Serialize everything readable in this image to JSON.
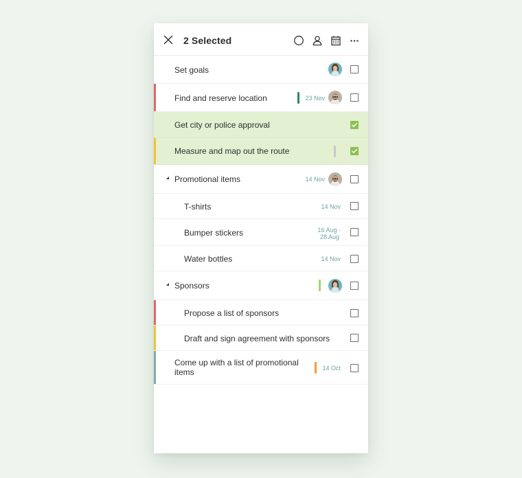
{
  "header": {
    "title": "2 Selected",
    "icons": [
      "close-icon",
      "circle-icon",
      "person-icon",
      "calendar-icon",
      "more-icon"
    ]
  },
  "colors": {
    "selected_bg": "#e3f0d2",
    "check_green": "#8cc152",
    "priority_red": "#e06666",
    "priority_yellow": "#f1c232",
    "priority_teal": "#7fa8b0",
    "tag_green": "#2e8b57",
    "tag_gray": "#c8c8c8",
    "tag_lightgreen": "#a7d36b",
    "tag_orange": "#f29d38",
    "date_color": "#6aa4a4"
  },
  "tasks": [
    {
      "label": "Set goals",
      "date": "",
      "avatar": "avatar-woman",
      "checked": false,
      "priority": "",
      "tag": ""
    },
    {
      "label": "Find and reserve location",
      "date": "23 Nov",
      "avatar": "avatar-man",
      "checked": false,
      "priority": "red",
      "tag": "green"
    },
    {
      "label": "Get city or police approval",
      "date": "",
      "avatar": "",
      "checked": true,
      "priority": "",
      "tag": ""
    },
    {
      "label": "Measure and map out the route",
      "date": "",
      "avatar": "",
      "checked": true,
      "priority": "yellow",
      "tag": "gray"
    },
    {
      "label": "Promotional items",
      "date": "14 Nov",
      "avatar": "avatar-man",
      "checked": false,
      "priority": "",
      "tag": "",
      "expandable": true
    },
    {
      "label": "T-shirts",
      "date": "14 Nov",
      "avatar": "",
      "checked": false,
      "subtask": true
    },
    {
      "label": "Bumper stickers",
      "date": "16 Aug -\n28 Aug",
      "date_line1": "16 Aug -",
      "date_line2": "28 Aug",
      "avatar": "",
      "checked": false,
      "subtask": true
    },
    {
      "label": "Water bottles",
      "date": "14 Nov",
      "avatar": "",
      "checked": false,
      "subtask": true
    },
    {
      "label": "Sponsors",
      "date": "",
      "avatar": "avatar-woman",
      "checked": false,
      "tag": "lightgreen",
      "expandable": true
    },
    {
      "label": "Propose a list of sponsors",
      "date": "",
      "avatar": "",
      "checked": false,
      "priority": "red",
      "subtask": true
    },
    {
      "label": "Draft and sign agreement with sponsors",
      "date": "",
      "avatar": "",
      "checked": false,
      "priority": "yellow",
      "subtask": true
    },
    {
      "label": "Come up with a list of promotional items",
      "date": "14 Oct",
      "avatar": "",
      "checked": false,
      "priority": "teal",
      "tag": "orange"
    }
  ]
}
